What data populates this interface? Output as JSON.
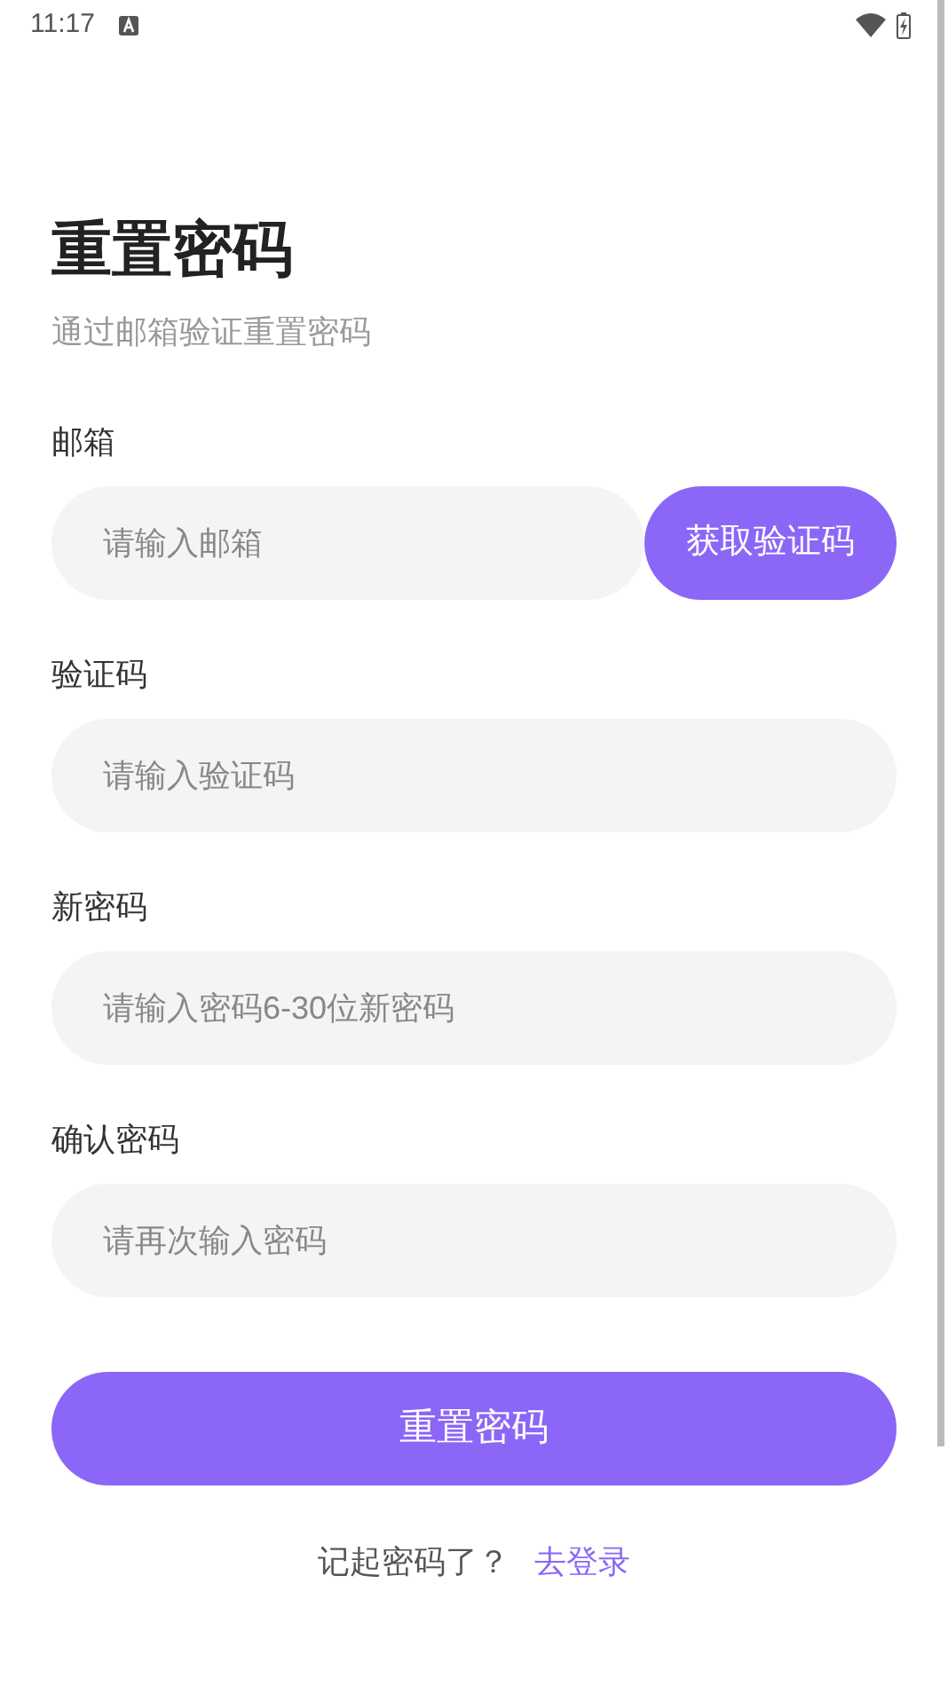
{
  "status_bar": {
    "time": "11:17"
  },
  "title": "重置密码",
  "subtitle": "通过邮箱验证重置密码",
  "fields": [
    {
      "label": "邮箱",
      "placeholder": "请输入邮箱",
      "action": "获取验证码"
    },
    {
      "label": "验证码",
      "placeholder": "请输入验证码"
    },
    {
      "label": "新密码",
      "placeholder": "请输入密码6-30位新密码"
    },
    {
      "label": "确认密码",
      "placeholder": "请再次输入密码"
    }
  ],
  "submit": "重置密码",
  "footer": {
    "text": "记起密码了？",
    "link": "去登录"
  }
}
